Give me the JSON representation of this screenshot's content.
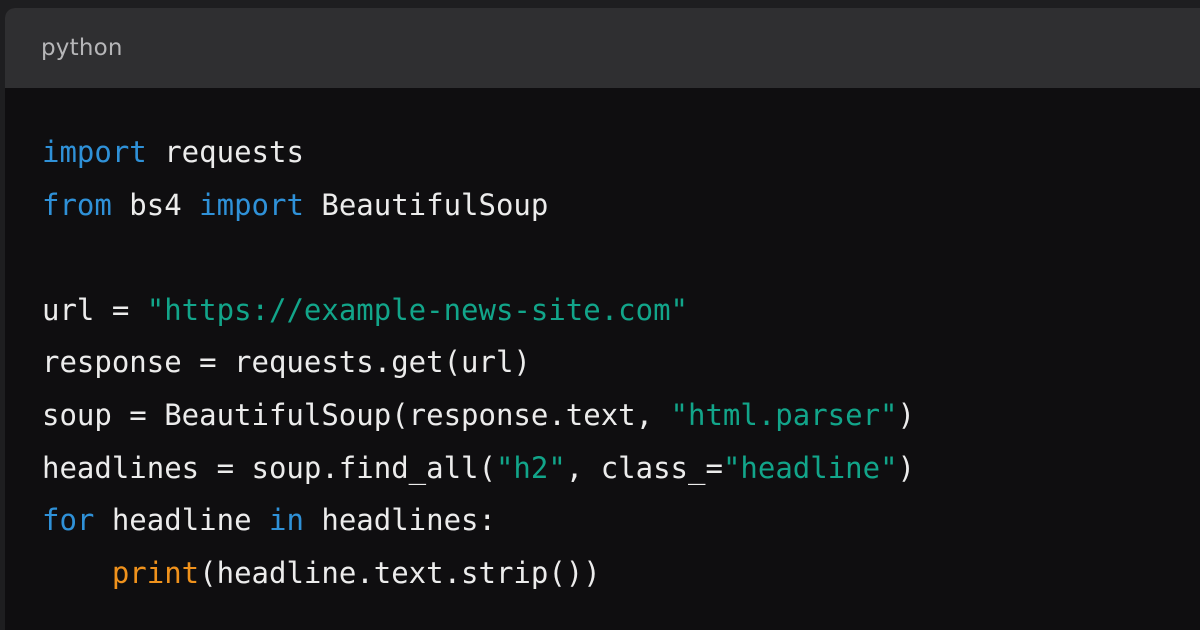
{
  "code_block": {
    "language": "python",
    "lines": [
      [
        {
          "t": "keyword",
          "v": "import"
        },
        {
          "t": "plain",
          "v": " requests"
        }
      ],
      [
        {
          "t": "keyword",
          "v": "from"
        },
        {
          "t": "plain",
          "v": " bs4 "
        },
        {
          "t": "keyword",
          "v": "import"
        },
        {
          "t": "plain",
          "v": " BeautifulSoup"
        }
      ],
      [],
      [
        {
          "t": "plain",
          "v": "url = "
        },
        {
          "t": "string",
          "v": "\"https://example-news-site.com\""
        }
      ],
      [
        {
          "t": "plain",
          "v": "response = requests.get(url)"
        }
      ],
      [
        {
          "t": "plain",
          "v": "soup = BeautifulSoup(response.text, "
        },
        {
          "t": "string",
          "v": "\"html.parser\""
        },
        {
          "t": "plain",
          "v": ")"
        }
      ],
      [
        {
          "t": "plain",
          "v": "headlines = soup.find_all("
        },
        {
          "t": "string",
          "v": "\"h2\""
        },
        {
          "t": "plain",
          "v": ", class_="
        },
        {
          "t": "string",
          "v": "\"headline\""
        },
        {
          "t": "plain",
          "v": ")"
        }
      ],
      [
        {
          "t": "keyword",
          "v": "for"
        },
        {
          "t": "plain",
          "v": " headline "
        },
        {
          "t": "keyword",
          "v": "in"
        },
        {
          "t": "plain",
          "v": " headlines:"
        }
      ],
      [
        {
          "t": "plain",
          "v": "    "
        },
        {
          "t": "builtin",
          "v": "print"
        },
        {
          "t": "plain",
          "v": "(headline.text.strip())"
        }
      ]
    ]
  },
  "colors": {
    "keyword": "#2f91d8",
    "string": "#12a58a",
    "builtin": "#f0921c",
    "plain": "#ececec",
    "header_bg": "#2f2f31",
    "body_bg": "#0f0e10"
  }
}
